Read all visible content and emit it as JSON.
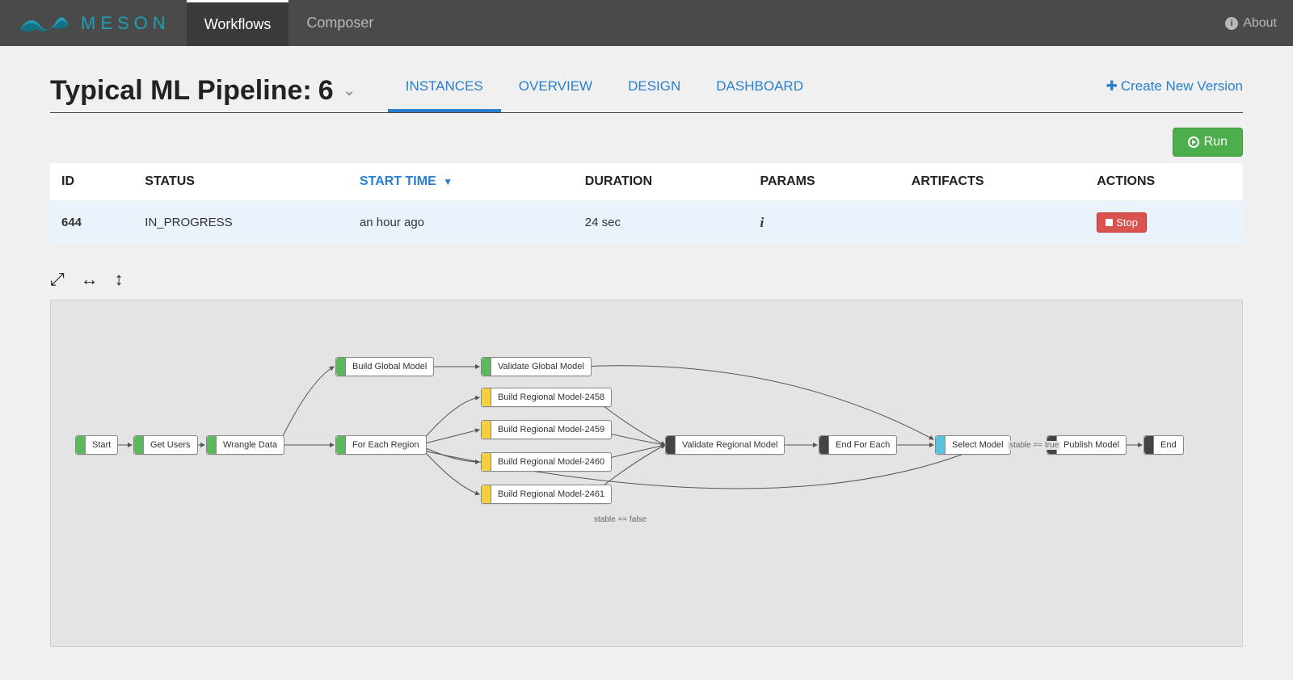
{
  "brand": {
    "name": "meson",
    "about": "About"
  },
  "topnav": {
    "tabs": [
      "Workflows",
      "Composer"
    ],
    "active": 0
  },
  "workflow": {
    "name": "Typical ML Pipeline:",
    "version": "6",
    "create_label": "Create New Version"
  },
  "subtabs": {
    "items": [
      "INSTANCES",
      "OVERVIEW",
      "DESIGN",
      "DASHBOARD"
    ],
    "active": 0
  },
  "run": {
    "label": "Run"
  },
  "table": {
    "columns": {
      "id": "ID",
      "status": "STATUS",
      "start": "START TIME",
      "duration": "DURATION",
      "params": "PARAMS",
      "artifacts": "ARTIFACTS",
      "actions": "ACTIONS"
    },
    "sort_indicator": "▼",
    "rows": [
      {
        "id": "644",
        "status": "IN_PROGRESS",
        "start": "an hour ago",
        "duration": "24 sec",
        "stop_label": "Stop"
      }
    ]
  },
  "diagram": {
    "edge_labels": {
      "true": "stable == true",
      "false": "stable == false"
    },
    "nodes": {
      "start": "Start",
      "get_users": "Get Users",
      "wrangle": "Wrangle Data",
      "build_global": "Build Global Model",
      "validate_global": "Validate Global Model",
      "for_each": "For Each Region",
      "br1": "Build Regional Model-2458",
      "br2": "Build Regional Model-2459",
      "br3": "Build Regional Model-2460",
      "br4": "Build Regional Model-2461",
      "validate_regional": "Validate Regional Model",
      "end_for_each": "End For Each",
      "select_model": "Select Model",
      "publish": "Publish Model",
      "end": "End"
    }
  }
}
